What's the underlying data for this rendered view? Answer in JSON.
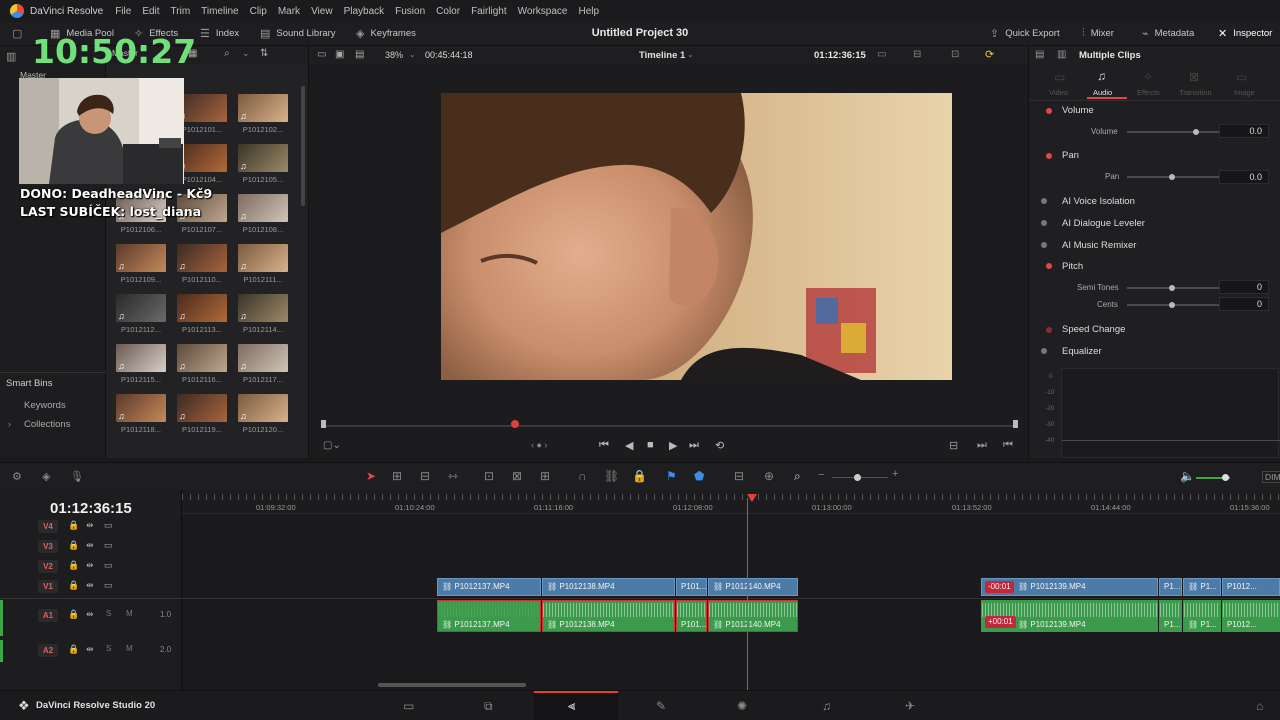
{
  "menubar": {
    "app": "DaVinci Resolve",
    "items": [
      "File",
      "Edit",
      "Trim",
      "Timeline",
      "Clip",
      "Mark",
      "View",
      "Playback",
      "Fusion",
      "Color",
      "Fairlight",
      "Workspace",
      "Help"
    ]
  },
  "toolbar": {
    "media_pool": "Media Pool",
    "effects": "Effects",
    "index": "Index",
    "sound_library": "Sound Library",
    "keyframes": "Keyframes",
    "project_title": "Untitled Project 30",
    "quick_export": "Quick Export",
    "mixer": "Mixer",
    "metadata": "Metadata",
    "inspector": "Inspector"
  },
  "overlay": {
    "clock": "10:50:27",
    "donation": "DONO: DeadheadVinc - Kč9",
    "last_sub": "LAST SUBÍČEK: lost_diana"
  },
  "left_panel": {
    "bin_labels": [
      "Master",
      "Master"
    ],
    "smart_bins": "Smart Bins",
    "keywords": "Keywords",
    "collections": "Collections"
  },
  "media_pool": {
    "thumbnails": [
      {
        "label": "",
        "col": 0,
        "row": 0
      },
      {
        "label": "P1012101...",
        "col": 1,
        "row": 0
      },
      {
        "label": "P1012102...",
        "col": 2,
        "row": 0
      },
      {
        "label": "",
        "col": 0,
        "row": 1
      },
      {
        "label": "P1012104...",
        "col": 1,
        "row": 1
      },
      {
        "label": "P1012105...",
        "col": 2,
        "row": 1
      },
      {
        "label": "P1012106...",
        "col": 0,
        "row": 2
      },
      {
        "label": "P1012107...",
        "col": 1,
        "row": 2
      },
      {
        "label": "P1012108...",
        "col": 2,
        "row": 2
      },
      {
        "label": "P1012109...",
        "col": 0,
        "row": 3
      },
      {
        "label": "P1012110...",
        "col": 1,
        "row": 3
      },
      {
        "label": "P1012111...",
        "col": 2,
        "row": 3
      },
      {
        "label": "P1012112...",
        "col": 0,
        "row": 4
      },
      {
        "label": "P1012113...",
        "col": 1,
        "row": 4
      },
      {
        "label": "P1012114...",
        "col": 2,
        "row": 4
      },
      {
        "label": "P1012115...",
        "col": 0,
        "row": 5
      },
      {
        "label": "P1012116...",
        "col": 1,
        "row": 5
      },
      {
        "label": "P1012117...",
        "col": 2,
        "row": 5
      },
      {
        "label": "P1012118...",
        "col": 0,
        "row": 6
      },
      {
        "label": "P1012119...",
        "col": 1,
        "row": 6
      },
      {
        "label": "P1012120...",
        "col": 2,
        "row": 6
      }
    ]
  },
  "viewer": {
    "zoom": "38%",
    "source_timecode": "00:45:44:18",
    "timeline_name": "Timeline 1",
    "record_timecode": "01:12:36:15"
  },
  "inspector": {
    "header": "Multiple Clips",
    "tabs": [
      "Video",
      "Audio",
      "Effects",
      "Transition",
      "Image"
    ],
    "active_tab": "Audio",
    "sections": {
      "volume": "Volume",
      "volume_param": "Volume",
      "volume_value": "0.0",
      "pan": "Pan",
      "pan_param": "Pan",
      "pan_value": "0.0",
      "ai_voice": "AI Voice Isolation",
      "ai_dialogue": "AI Dialogue Leveler",
      "ai_music": "AI Music Remixer",
      "pitch": "Pitch",
      "semi_tones": "Semi Tones",
      "semi_value": "0",
      "cents": "Cents",
      "cents_value": "0",
      "speed_change": "Speed Change",
      "equalizer": "Equalizer"
    },
    "eq_scale": [
      "0",
      "-10",
      "-20",
      "-30",
      "-40"
    ]
  },
  "timeline": {
    "timecode": "01:12:36:15",
    "ruler": [
      "01:09:32:00",
      "01:10:24:00",
      "01:11:16:00",
      "01:12:08:00",
      "01:13:00:00",
      "01:13:52:00",
      "01:14:44:00",
      "01:15:36:00"
    ],
    "tracks": {
      "v4": "V4",
      "v3": "V3",
      "v2": "V2",
      "v1": "V1",
      "a1": "A1",
      "a1_level": "1.0",
      "a2": "A2",
      "a2_level": "2.0"
    },
    "video_clips": [
      "P1012137.MP4",
      "P1012138.MP4",
      "P101...",
      "P1012140.MP4",
      "P1012139.MP4",
      "P1...",
      "P1...",
      "P1012..."
    ],
    "audio_clips": [
      "P1012137.MP4",
      "P1012138.MP4",
      "P101...",
      "P1012140.MP4",
      "P1012139.MP4",
      "P1...",
      "P1...",
      "P1012..."
    ],
    "offset_video": "-00:01",
    "offset_audio": "+00:01",
    "dim_label": "DIM"
  },
  "pagebar": {
    "product": "DaVinci Resolve Studio 20"
  }
}
